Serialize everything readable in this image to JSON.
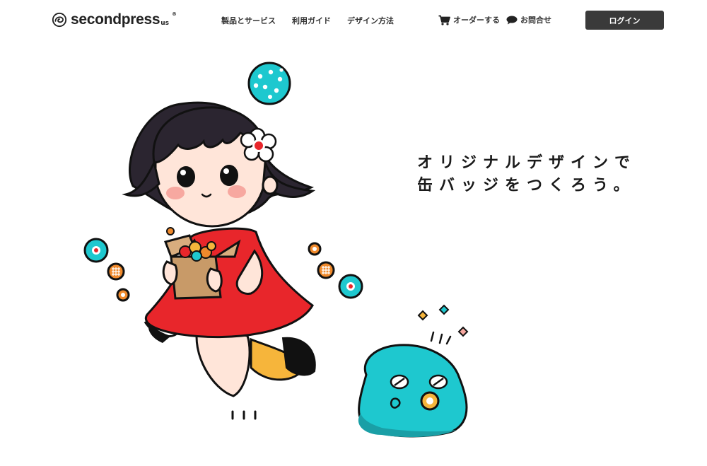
{
  "brand": {
    "name": "secondpress",
    "suffix": "us",
    "registered": "®",
    "icon": "swirl-logo-icon"
  },
  "nav": {
    "items": [
      {
        "label": "製品とサービス"
      },
      {
        "label": "利用ガイド"
      },
      {
        "label": "デザイン方法"
      }
    ]
  },
  "utility": {
    "order": {
      "label": "オーダーする",
      "icon": "cart-icon"
    },
    "contact": {
      "label": "お問合せ",
      "icon": "speech-bubble-icon"
    }
  },
  "login": {
    "label": "ログイン"
  },
  "hero": {
    "line1": "オリジナルデザインで",
    "line2": "缶バッジをつくろう。"
  },
  "colors": {
    "button_bg": "#3a3a3a",
    "dress_red": "#e8262b",
    "teal": "#1ec8cf",
    "orange": "#f08a2c",
    "yellow": "#f6b53b",
    "hair": "#2b2530"
  }
}
